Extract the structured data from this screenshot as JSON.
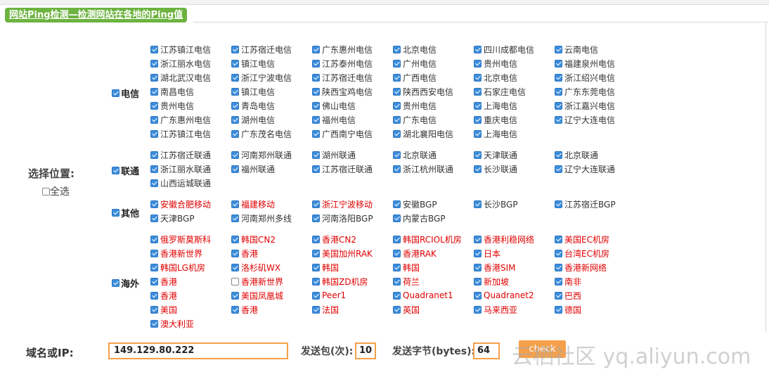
{
  "header": {
    "title": "网站Ping检测—检测网站在各地的Ping值"
  },
  "select": {
    "label": "选择位置:",
    "all_label": "全选",
    "all_checked": false
  },
  "groups": [
    {
      "label": "电信",
      "checked": true,
      "color": "black",
      "items": [
        "江苏镇江电信",
        "江苏宿迁电信",
        "广东惠州电信",
        "北京电信",
        "四川成都电信",
        "云南电信",
        "浙江丽水电信",
        "镇江电信",
        "江苏泰州电信",
        "广州电信",
        "贵州电信",
        "福建泉州电信",
        "湖北武汉电信",
        "浙江宁波电信",
        "江苏宿迁电信",
        "广西电信",
        "北京电信",
        "浙江绍兴电信",
        "南昌电信",
        "镇江电信",
        "陕西宝鸡电信",
        "陕西西安电信",
        "石家庄电信",
        "广东东莞电信",
        "贵州电信",
        "青岛电信",
        "佛山电信",
        "贵州电信",
        "上海电信",
        "浙江嘉兴电信",
        "广东惠州电信",
        "湖州电信",
        "福州电信",
        "广东电信",
        "重庆电信",
        "辽宁大连电信",
        "江苏镇江电信",
        "广东茂名电信",
        "广西南宁电信",
        "湖北襄阳电信",
        "上海电信"
      ]
    },
    {
      "label": "联通",
      "checked": true,
      "color": "black",
      "items": [
        "江苏宿迁联通",
        "河南郑州联通",
        "湖州联通",
        "北京联通",
        "天津联通",
        "北京联通",
        "浙江丽水联通",
        "福州联通",
        "江苏宿迁联通",
        "浙江杭州联通",
        "长沙联通",
        "辽宁大连联通",
        "山西运城联通"
      ]
    },
    {
      "label": "其他",
      "checked": true,
      "color": "mixed",
      "items": [
        "安徽合肥移动",
        "福建移动",
        "浙江宁波移动",
        "安徽BGP",
        "长沙BGP",
        "江苏宿迁BGP",
        "天津BGP",
        "河南郑州多线",
        "河南洛阳BGP",
        "内蒙古BGP"
      ],
      "red_count": 3
    },
    {
      "label": "海外",
      "checked": true,
      "color": "red",
      "items": [
        "俄罗斯莫斯科",
        "韩国CN2",
        "香港CN2",
        "韩国RCIOL机房",
        "香港利稳网络",
        "美国EC机房",
        "香港新世界",
        "香港",
        "美国加州RAK",
        "香港RAK",
        "日本",
        "台湾EC机房",
        "韩国LG机房",
        "洛杉矶WX",
        "韩国",
        "韩国",
        "香港SIM",
        "香港新网络",
        "香港",
        "香港新世界",
        "韩国ZD机房",
        "荷兰",
        "新加坡",
        "南非",
        "香港",
        "美国凤凰城",
        "Peer1",
        "Quadranet1",
        "Quadranet2",
        "巴西",
        "美国",
        "香港",
        "法国",
        "英国",
        "马来西亚",
        "德国",
        "澳大利亚"
      ],
      "unchecked_index": 19
    }
  ],
  "form": {
    "domain_label": "域名或IP:",
    "domain_value": "149.129.80.222",
    "packets_label": "发送包(次):",
    "packets_value": "10",
    "bytes_label": "发送字节(bytes):",
    "bytes_value": "64",
    "check_label": "check"
  },
  "watermark": "云栖社区 yq.aliyun.com",
  "colors": {
    "accent_green": "#6cb33f",
    "input_border": "#f5a04a",
    "red_text": "#e00000",
    "checkbox_blue": "#3b8ddb"
  }
}
